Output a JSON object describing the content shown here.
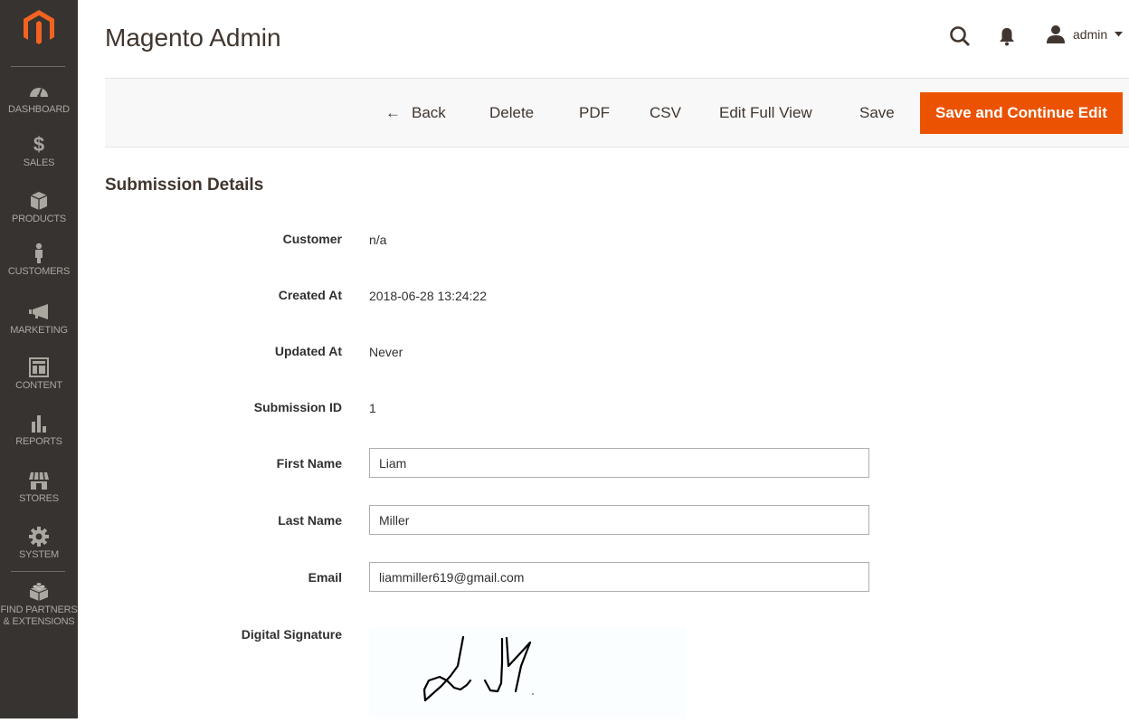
{
  "app": {
    "title": "Magento Admin"
  },
  "header": {
    "user_name": "admin"
  },
  "sidebar": {
    "items": [
      {
        "label": "Dashboard",
        "icon": "dashboard-gauge-icon"
      },
      {
        "label": "Sales",
        "icon": "dollar-icon"
      },
      {
        "label": "Products",
        "icon": "box-icon"
      },
      {
        "label": "Customers",
        "icon": "person-icon"
      },
      {
        "label": "Marketing",
        "icon": "megaphone-icon"
      },
      {
        "label": "Content",
        "icon": "layout-icon"
      },
      {
        "label": "Reports",
        "icon": "bar-chart-icon"
      },
      {
        "label": "Stores",
        "icon": "storefront-icon"
      },
      {
        "label": "System",
        "icon": "gear-icon"
      }
    ],
    "extra": {
      "line1": "Find Partners",
      "line2": "& Extensions",
      "icon": "lego-brick-icon"
    }
  },
  "toolbar": {
    "back": "Back",
    "delete": "Delete",
    "pdf": "PDF",
    "csv": "CSV",
    "edit_full_view": "Edit Full View",
    "save": "Save",
    "save_continue": "Save and Continue Edit",
    "primary_color": "#eb5202"
  },
  "section": {
    "title": "Submission Details"
  },
  "details": {
    "customer": {
      "label": "Customer",
      "value": "n/a"
    },
    "created_at": {
      "label": "Created At",
      "value": "2018-06-28 13:24:22"
    },
    "updated_at": {
      "label": "Updated At",
      "value": "Never"
    },
    "submission_id": {
      "label": "Submission ID",
      "value": "1"
    },
    "first_name": {
      "label": "First Name",
      "value": "Liam"
    },
    "last_name": {
      "label": "Last Name",
      "value": "Miller"
    },
    "email": {
      "label": "Email",
      "value": "liammiller619@gmail.com"
    },
    "signature": {
      "label": "Digital Signature"
    }
  }
}
